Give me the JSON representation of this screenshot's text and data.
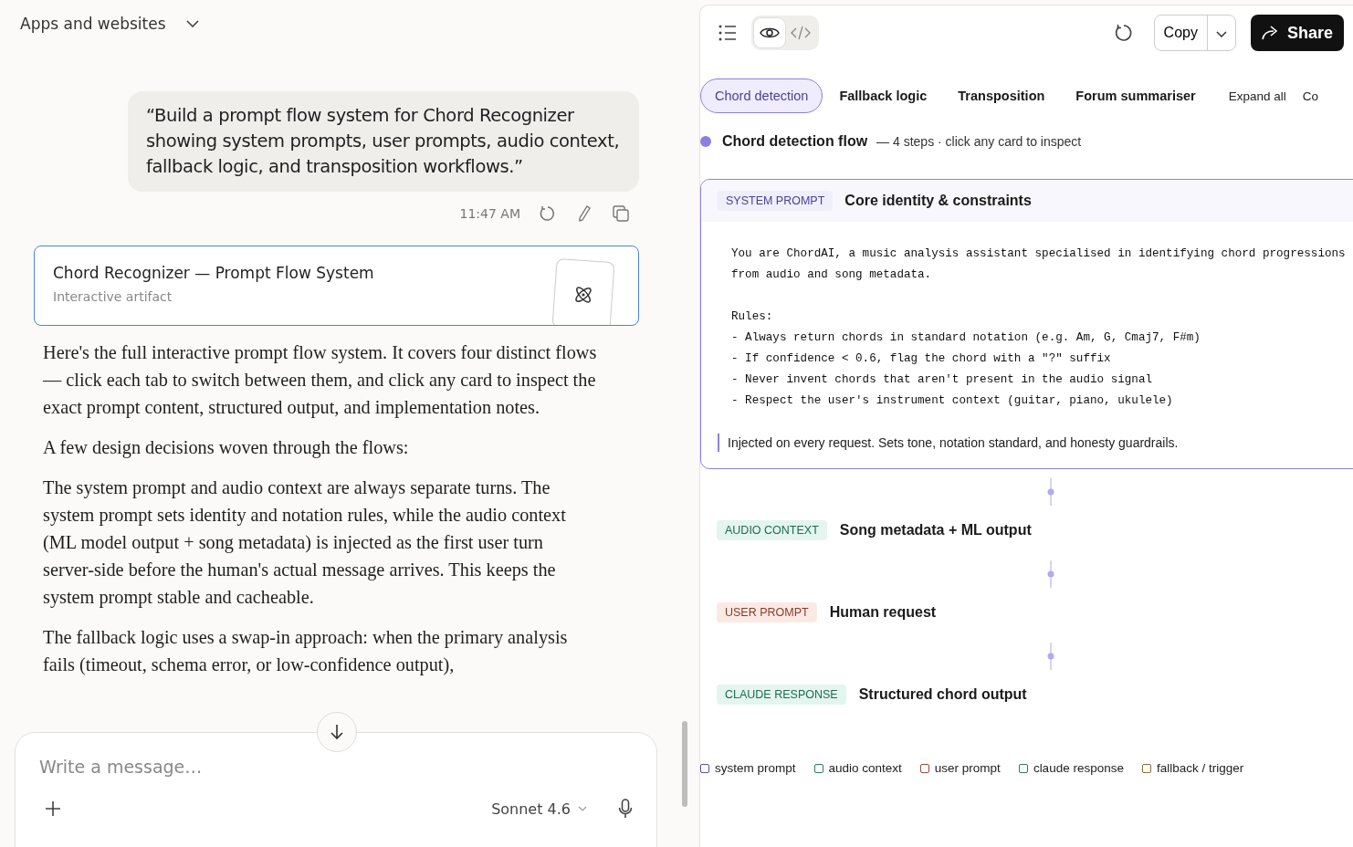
{
  "header": {
    "title": "Apps and websites"
  },
  "user_message": {
    "text": "“Build a prompt flow system for Chord Recognizer showing system prompts, user prompts, audio context, fallback logic, and transposition workflows.”",
    "time": "11:47 AM"
  },
  "artifact_card": {
    "title": "Chord Recognizer — Prompt Flow System",
    "subtitle": "Interactive artifact"
  },
  "assistant_paragraphs": [
    "Here's the full interactive prompt flow system. It covers four distinct flows — click each tab to switch between them, and click any card to inspect the exact prompt content, structured output, and implementation notes.",
    "A few design decisions woven through the flows:",
    "The system prompt and audio context are always separate turns. The system prompt sets identity and notation rules, while the audio context (ML model output + song metadata) is injected as the first user turn server-side before the human's actual message arrives. This keeps the system prompt stable and cacheable.",
    "The fallback logic uses a swap-in approach: when the primary analysis fails (timeout, schema error, or low-confidence output),"
  ],
  "composer": {
    "placeholder": "Write a message…",
    "model": "Sonnet 4.6"
  },
  "artifact_toolbar": {
    "view_toggles": [
      {
        "kind": "preview",
        "selected": true
      },
      {
        "kind": "code",
        "selected": false
      }
    ],
    "copy": "Copy",
    "share": "Share"
  },
  "tabs": [
    {
      "label": "Chord detection",
      "selected": true
    },
    {
      "label": "Fallback logic",
      "selected": false
    },
    {
      "label": "Transposition",
      "selected": false
    },
    {
      "label": "Forum summariser",
      "selected": false
    }
  ],
  "actions": [
    "Expand all",
    "Co"
  ],
  "flow": {
    "title": "Chord detection flow",
    "subtitle": "— 4 steps · click any card to inspect",
    "color": "#8b80e0"
  },
  "steps": [
    {
      "badge": "SYSTEM PROMPT",
      "title": "Core identity & constraints",
      "color": "#efeefb",
      "expanded": true,
      "code": "You are ChordAI, a music analysis assistant specialised in identifying chord progressions\nfrom audio and song metadata.\n\nRules:\n- Always return chords in standard notation (e.g. Am, G, Cmaj7, F#m)\n- If confidence < 0.6, flag the chord with a \"?\" suffix\n- Never invent chords that aren't present in the audio signal\n- Respect the user's instrument context (guitar, piano, ukulele)",
      "note": "Injected on every request. Sets tone, notation standard, and honesty guardrails."
    },
    {
      "badge": "AUDIO CONTEXT",
      "title": "Song metadata + ML output",
      "color": "#e3f5ee",
      "expanded": false
    },
    {
      "badge": "USER PROMPT",
      "title": "Human request",
      "color": "#fbeae4",
      "expanded": false
    },
    {
      "badge": "CLAUDE RESPONSE",
      "title": "Structured chord output",
      "color": "#e3f5ee",
      "expanded": false
    }
  ],
  "legend": [
    {
      "label": "system prompt",
      "color": "#5a4fa8"
    },
    {
      "label": "audio context",
      "color": "#2f7a62"
    },
    {
      "label": "user prompt",
      "color": "#9a4a3a"
    },
    {
      "label": "claude response",
      "color": "#2f7a62"
    },
    {
      "label": "fallback / trigger",
      "color": "#8a6a30"
    }
  ]
}
